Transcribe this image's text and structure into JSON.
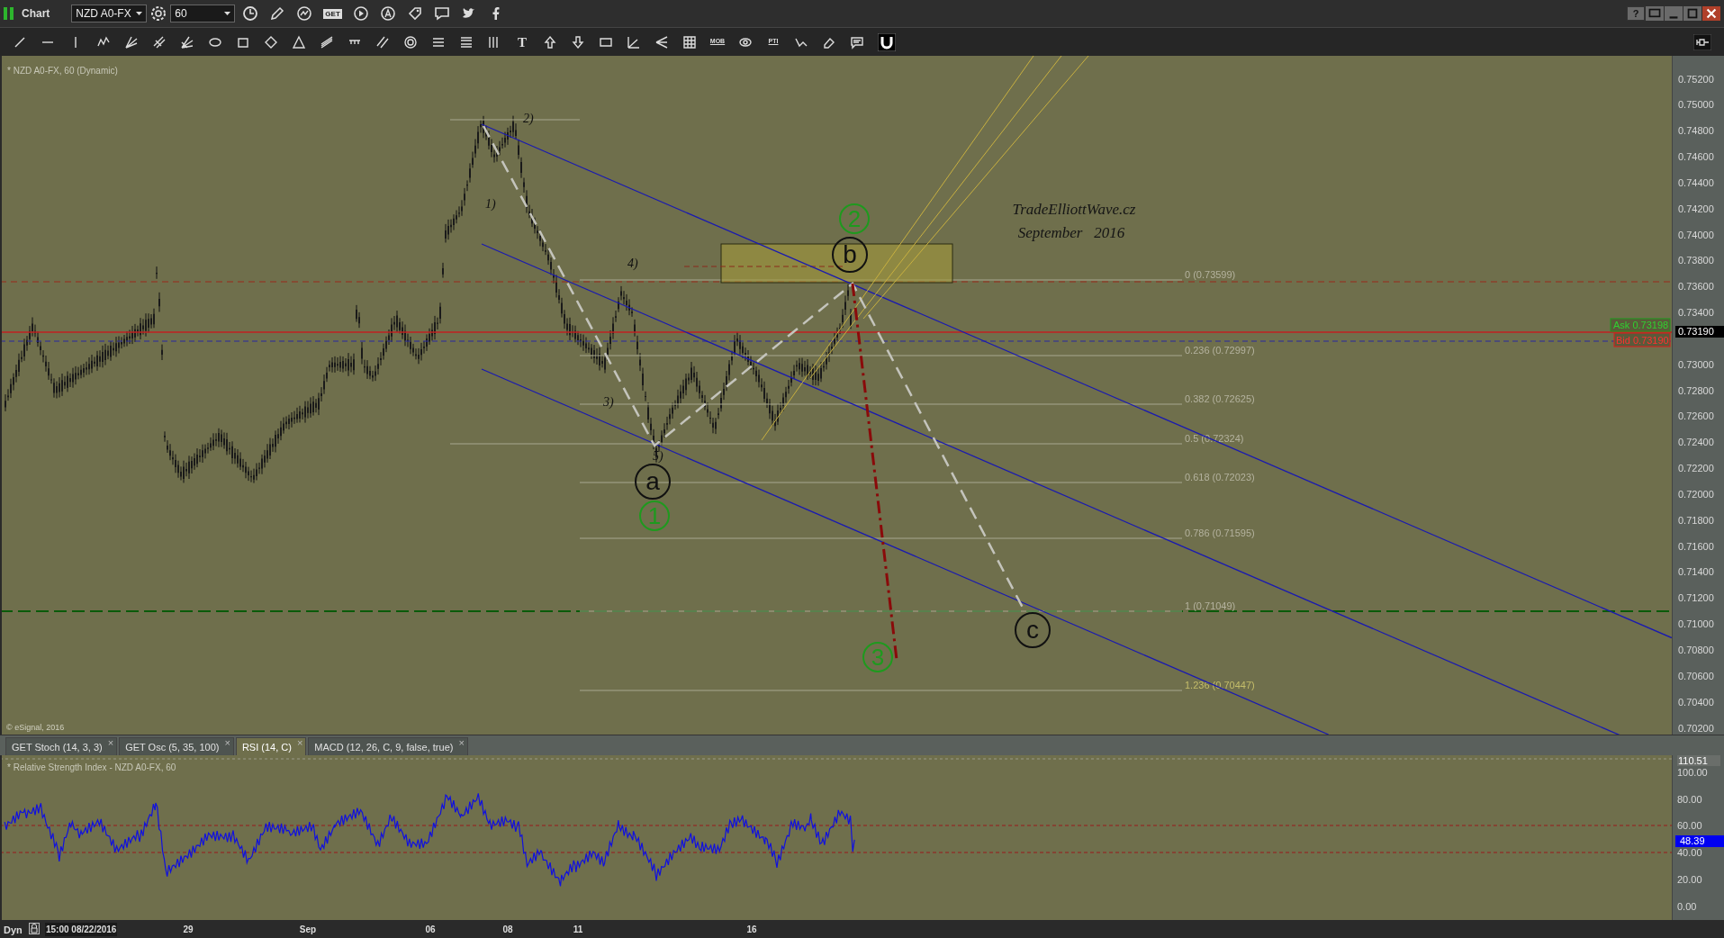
{
  "title_bar": {
    "title": "Chart",
    "symbol": "NZD A0-FX",
    "interval": "60",
    "help": "?"
  },
  "toolbar": {
    "labels": [
      "GET",
      "T",
      "MOB",
      "PTI"
    ]
  },
  "price_chart": {
    "caption": "* NZD A0-FX, 60 (Dynamic)",
    "copyright": "© eSignal, 2016",
    "wave_labels": [
      "1)",
      "2)",
      "3)",
      "4)",
      "5)"
    ],
    "wave_circles": [
      {
        "text": "2",
        "color": "#1e9a1e"
      },
      {
        "text": "b",
        "color": "#111111"
      },
      {
        "text": "a",
        "color": "#111111"
      },
      {
        "text": "1",
        "color": "#1e9a1e"
      },
      {
        "text": "3",
        "color": "#1e9a1e"
      },
      {
        "text": "c",
        "color": "#111111"
      }
    ],
    "annotation": [
      "TradeElliottWave.cz",
      "September   2016"
    ],
    "fib_levels": [
      "0 (0.73599)",
      "0.236 (0.72997)",
      "0.382 (0.72625)",
      "0.5 (0.72324)",
      "0.618 (0.72023)",
      "0.786 (0.71595)",
      "1 (0.71049)",
      "1.236 (0.70447)"
    ],
    "ask": "Ask 0.73198",
    "bid": "Bid 0.73190",
    "price_axis": [
      "0.75200",
      "0.75000",
      "0.74800",
      "0.74600",
      "0.74400",
      "0.74200",
      "0.74000",
      "0.73800",
      "0.73600",
      "0.73400",
      "0.73000",
      "0.72800",
      "0.72600",
      "0.72400",
      "0.72200",
      "0.72000",
      "0.71800",
      "0.71600",
      "0.71400",
      "0.71200",
      "0.71000",
      "0.70800",
      "0.70600",
      "0.70400",
      "0.70200"
    ],
    "last_price": "0.73190"
  },
  "indicator_tabs": [
    {
      "label": "GET Stoch (14, 3, 3)",
      "close": "×",
      "selected": false
    },
    {
      "label": "GET Osc (5, 35, 100)",
      "close": "×",
      "selected": false
    },
    {
      "label": "RSI (14, C)",
      "close": "×",
      "selected": true
    },
    {
      "label": "MACD (12, 26, C, 9, false, true)",
      "close": "×",
      "selected": false
    }
  ],
  "rsi_pane": {
    "caption": "* Relative Strength Index - NZD A0-FX, 60",
    "axis": [
      "110.51",
      "100.00",
      "80.00",
      "60.00",
      "40.00",
      "20.00",
      "0.00"
    ],
    "last_value": "48.39"
  },
  "time_axis": {
    "mode": "Dyn",
    "start": "15:00 08/22/2016",
    "labels": [
      "29",
      "Sep",
      "06",
      "08",
      "11",
      "16"
    ]
  }
}
